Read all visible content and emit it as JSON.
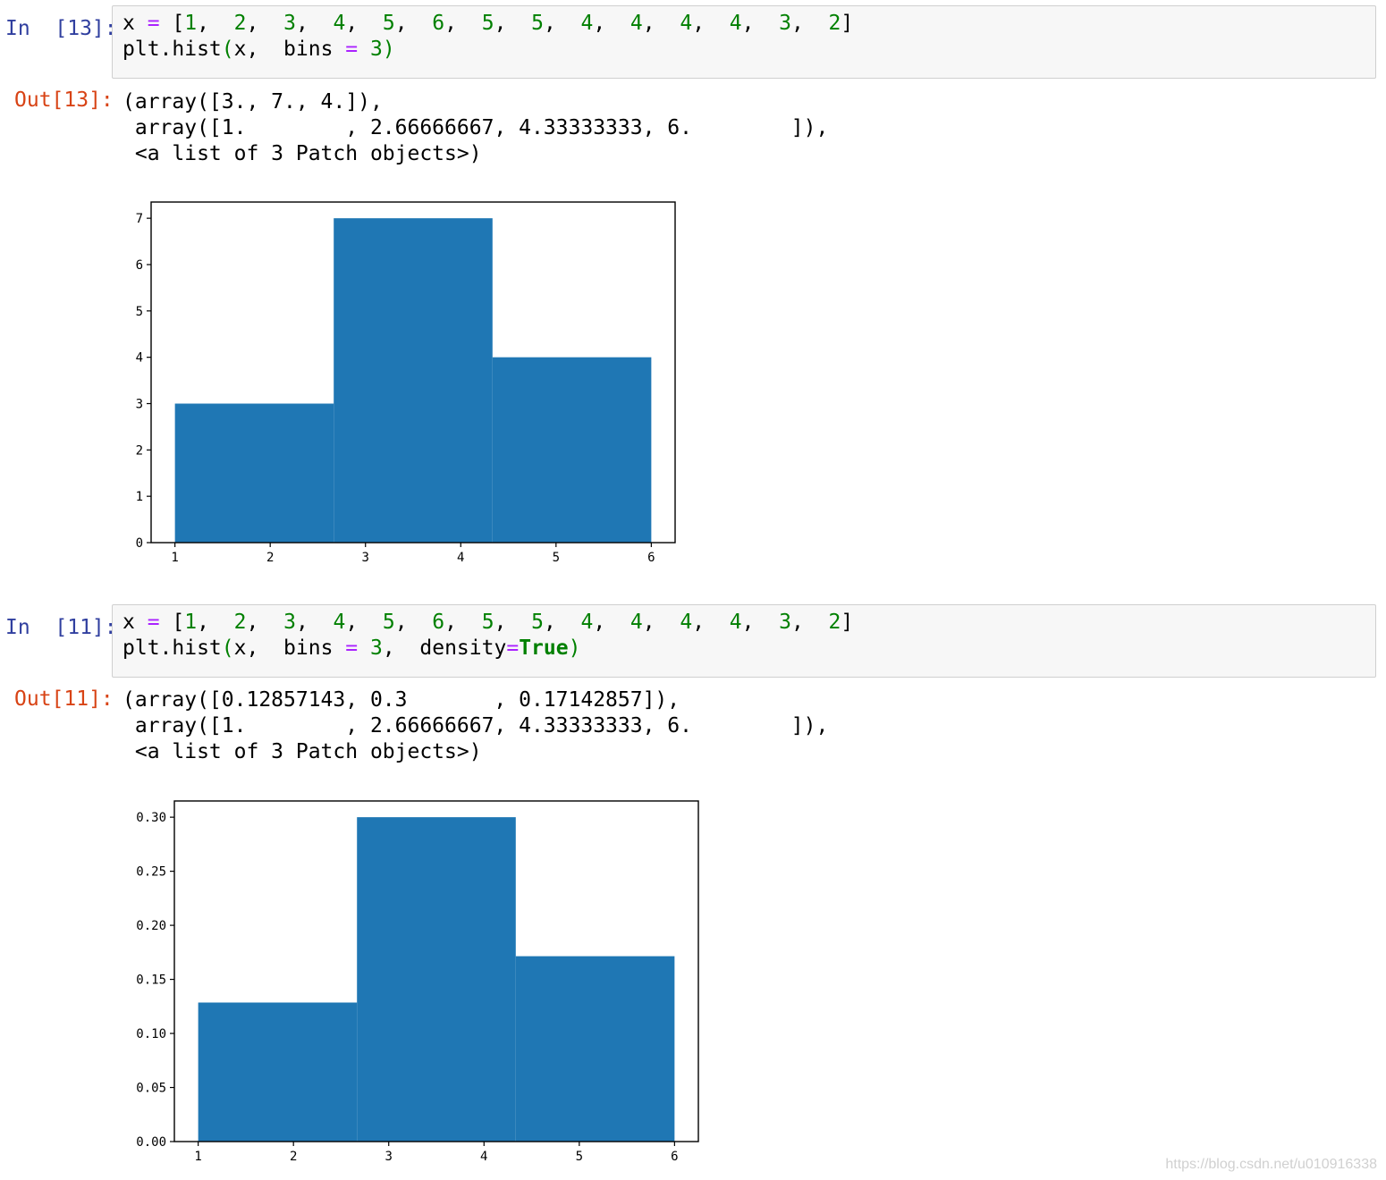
{
  "cells": [
    {
      "in_prompt": "In  [13]:",
      "code_line1": [
        "x",
        " = ",
        "[",
        "1",
        ",  ",
        "2",
        ",  ",
        "3",
        ",  ",
        "4",
        ",  ",
        "5",
        ",  ",
        "6",
        ",  ",
        "5",
        ",  ",
        "5",
        ",  ",
        "4",
        ",  ",
        "4",
        ",  ",
        "4",
        ",  ",
        "4",
        ",  ",
        "3",
        ",  ",
        "2",
        "]"
      ],
      "code_line2": {
        "a": "plt.hist",
        "b": "(",
        "c": "x,  bins ",
        "d": "=",
        "e": " ",
        "f": "3",
        "g": ")"
      },
      "out_prompt": "Out[13]:",
      "out_lines": [
        "(array([3., 7., 4.]),",
        " array([1.        , 2.66666667, 4.33333333, 6.        ]),",
        " <a list of 3 Patch objects>)"
      ]
    },
    {
      "in_prompt": "In  [11]:",
      "code_line1": [
        "x",
        " = ",
        "[",
        "1",
        ",  ",
        "2",
        ",  ",
        "3",
        ",  ",
        "4",
        ",  ",
        "5",
        ",  ",
        "6",
        ",  ",
        "5",
        ",  ",
        "5",
        ",  ",
        "4",
        ",  ",
        "4",
        ",  ",
        "4",
        ",  ",
        "4",
        ",  ",
        "3",
        ",  ",
        "2",
        "]"
      ],
      "code_line2": {
        "a": "plt.hist",
        "b": "(",
        "c": "x,  bins ",
        "d": "=",
        "e": " ",
        "f": "3",
        "g": ",  density",
        "h": "=",
        "i": "True",
        "j": ")"
      },
      "out_prompt": "Out[11]:",
      "out_lines": [
        "(array([0.12857143, 0.3       , 0.17142857]),",
        " array([1.        , 2.66666667, 4.33333333, 6.        ]),",
        " <a list of 3 Patch objects>)"
      ]
    }
  ],
  "chart_data": [
    {
      "type": "bar",
      "bin_edges": [
        1,
        2.66666667,
        4.33333333,
        6
      ],
      "values": [
        3,
        7,
        4
      ],
      "xlim": [
        0.75,
        6.25
      ],
      "ylim": [
        0,
        7.35
      ],
      "xticks": [
        "1",
        "2",
        "3",
        "4",
        "5",
        "6"
      ],
      "xtick_values": [
        1,
        2,
        3,
        4,
        5,
        6
      ],
      "yticks": [
        "0",
        "1",
        "2",
        "3",
        "4",
        "5",
        "6",
        "7"
      ],
      "ytick_values": [
        0,
        1,
        2,
        3,
        4,
        5,
        6,
        7
      ],
      "color": "#1f77b4",
      "title": "",
      "xlabel": "",
      "ylabel": "",
      "grid": false
    },
    {
      "type": "bar",
      "bin_edges": [
        1,
        2.66666667,
        4.33333333,
        6
      ],
      "values": [
        0.12857143,
        0.3,
        0.17142857
      ],
      "xlim": [
        0.75,
        6.25
      ],
      "ylim": [
        0,
        0.315
      ],
      "xticks": [
        "1",
        "2",
        "3",
        "4",
        "5",
        "6"
      ],
      "xtick_values": [
        1,
        2,
        3,
        4,
        5,
        6
      ],
      "yticks": [
        "0.00",
        "0.05",
        "0.10",
        "0.15",
        "0.20",
        "0.25",
        "0.30"
      ],
      "ytick_values": [
        0,
        0.05,
        0.1,
        0.15,
        0.2,
        0.25,
        0.3
      ],
      "color": "#1f77b4",
      "title": "",
      "xlabel": "",
      "ylabel": "",
      "grid": false
    }
  ],
  "watermark": "https://blog.csdn.net/u010916338"
}
